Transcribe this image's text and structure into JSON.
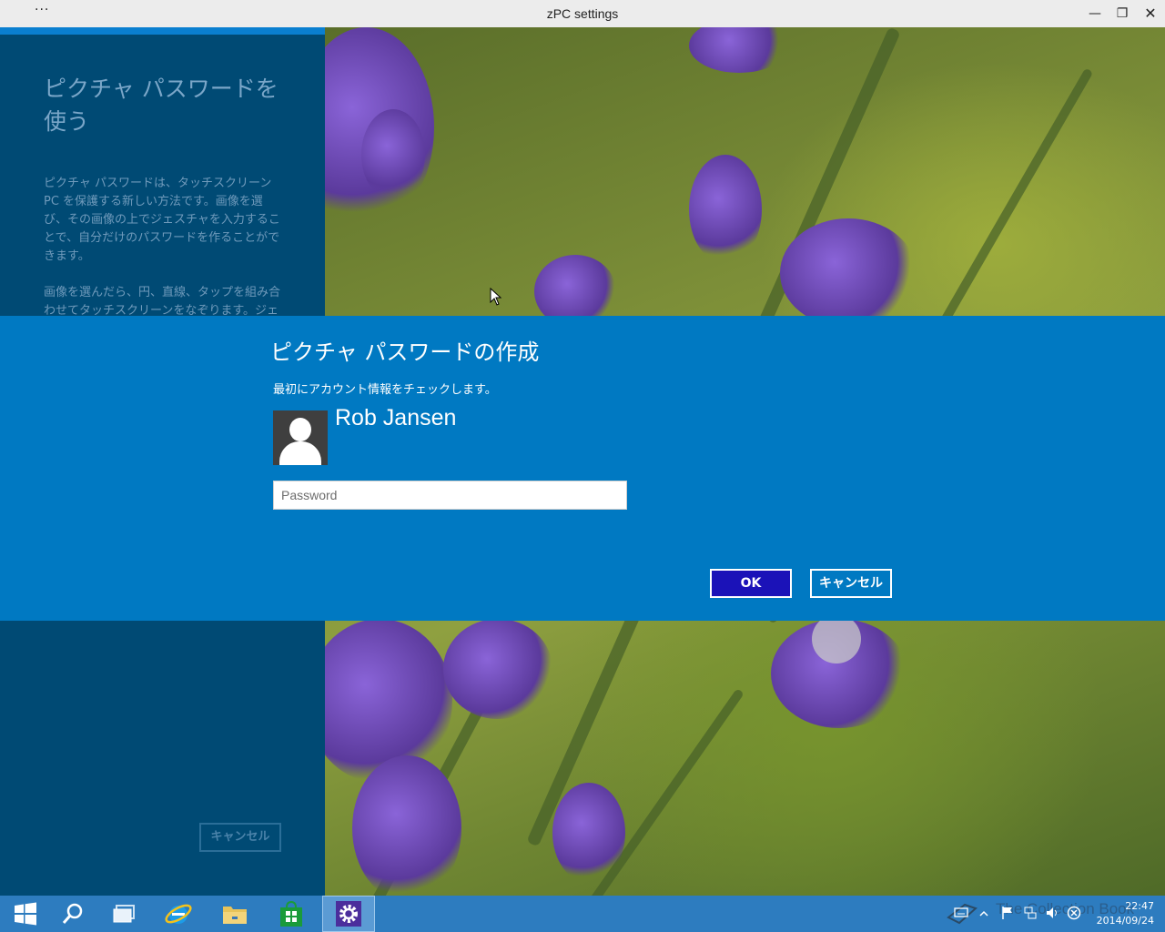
{
  "window": {
    "title": "zPC settings",
    "menu_glyph": "···",
    "minimize_glyph": "—",
    "maximize_glyph": "❐",
    "close_glyph": "✕"
  },
  "left_panel": {
    "title": "ピクチャ パスワードを使う",
    "paragraph1": "ピクチャ パスワードは、タッチスクリーン PC を保護する新しい方法です。画像を選び、その画像の上でジェスチャを入力することで、自分だけのパスワードを作ることができます。",
    "paragraph2": "画像を選んだら、円、直線、タップを組み合わせてタッチスクリーンをなぞります。ジェスチャの大きさ、位置、方向が、自分のピクチャ パ",
    "cancel_label": "キャンセル"
  },
  "dialog": {
    "title": "ピクチャ パスワードの作成",
    "subtitle": "最初にアカウント情報をチェックします。",
    "user_name": "Rob Jansen",
    "password_placeholder": "Password",
    "password_value": "",
    "ok_label": "OK",
    "cancel_label": "キャンセル"
  },
  "taskbar": {
    "items": [
      {
        "name": "start-button",
        "icon": "windows-logo-icon"
      },
      {
        "name": "search-button",
        "icon": "search-icon"
      },
      {
        "name": "task-view-button",
        "icon": "task-view-icon"
      },
      {
        "name": "internet-explorer-button",
        "icon": "internet-explorer-icon"
      },
      {
        "name": "file-explorer-button",
        "icon": "folder-icon"
      },
      {
        "name": "store-button",
        "icon": "store-icon"
      },
      {
        "name": "settings-button",
        "icon": "gear-icon",
        "active": true
      }
    ],
    "watermark": "The Collection Book",
    "time": "22:47",
    "date": "2014/09/24"
  },
  "colors": {
    "dialog_bg": "#0079c2",
    "left_panel_bg": "#004a74",
    "ok_button_bg": "#1b12b8",
    "taskbar_bg": "#2d7cbf"
  }
}
